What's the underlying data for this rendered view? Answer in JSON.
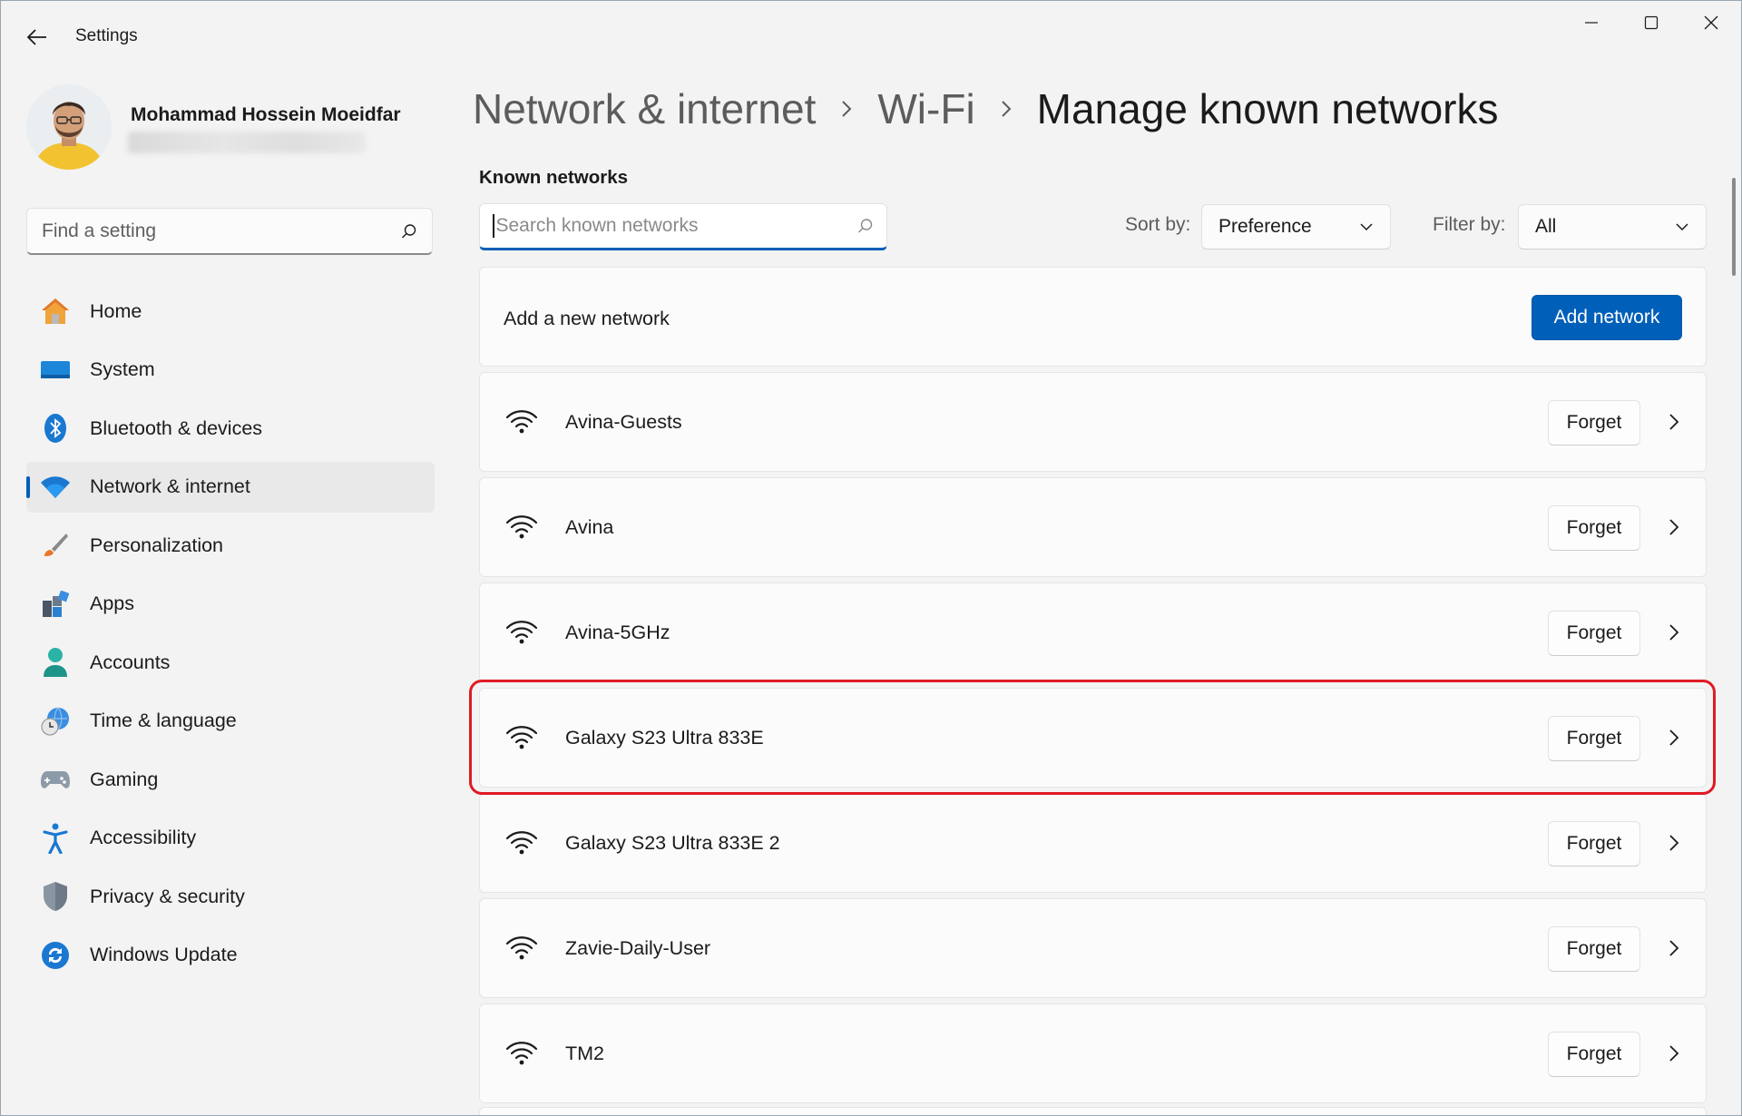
{
  "window": {
    "app_title": "Settings",
    "controls": [
      "minimize",
      "maximize",
      "close"
    ]
  },
  "profile": {
    "name": "Mohammad Hossein Moeidfar"
  },
  "sidebar": {
    "search_placeholder": "Find a setting",
    "items": [
      {
        "label": "Home",
        "icon": "home-icon",
        "active": false
      },
      {
        "label": "System",
        "icon": "system-icon",
        "active": false
      },
      {
        "label": "Bluetooth & devices",
        "icon": "bluetooth-icon",
        "active": false
      },
      {
        "label": "Network & internet",
        "icon": "wifi-icon",
        "active": true
      },
      {
        "label": "Personalization",
        "icon": "brush-icon",
        "active": false
      },
      {
        "label": "Apps",
        "icon": "apps-icon",
        "active": false
      },
      {
        "label": "Accounts",
        "icon": "person-icon",
        "active": false
      },
      {
        "label": "Time & language",
        "icon": "globe-clock-icon",
        "active": false
      },
      {
        "label": "Gaming",
        "icon": "gamepad-icon",
        "active": false
      },
      {
        "label": "Accessibility",
        "icon": "accessibility-icon",
        "active": false
      },
      {
        "label": "Privacy & security",
        "icon": "shield-icon",
        "active": false
      },
      {
        "label": "Windows Update",
        "icon": "update-icon",
        "active": false
      }
    ]
  },
  "breadcrumb": {
    "items": [
      "Network & internet",
      "Wi-Fi",
      "Manage known networks"
    ]
  },
  "main": {
    "section_title": "Known networks",
    "search_placeholder": "Search known networks",
    "sort_label": "Sort by:",
    "sort_value": "Preference",
    "filter_label": "Filter by:",
    "filter_value": "All",
    "add_label": "Add a new network",
    "add_button": "Add network",
    "forget_label": "Forget",
    "networks": [
      {
        "name": "Avina-Guests"
      },
      {
        "name": "Avina"
      },
      {
        "name": "Avina-5GHz"
      },
      {
        "name": "Galaxy S23 Ultra 833E",
        "highlighted": true
      },
      {
        "name": "Galaxy S23 Ultra 833E 2"
      },
      {
        "name": "Zavie-Daily-User"
      },
      {
        "name": "TM2"
      }
    ]
  },
  "colors": {
    "accent": "#005fb8",
    "highlight": "#e01b24",
    "background": "#f3f3f3",
    "card": "#fbfbfb"
  }
}
